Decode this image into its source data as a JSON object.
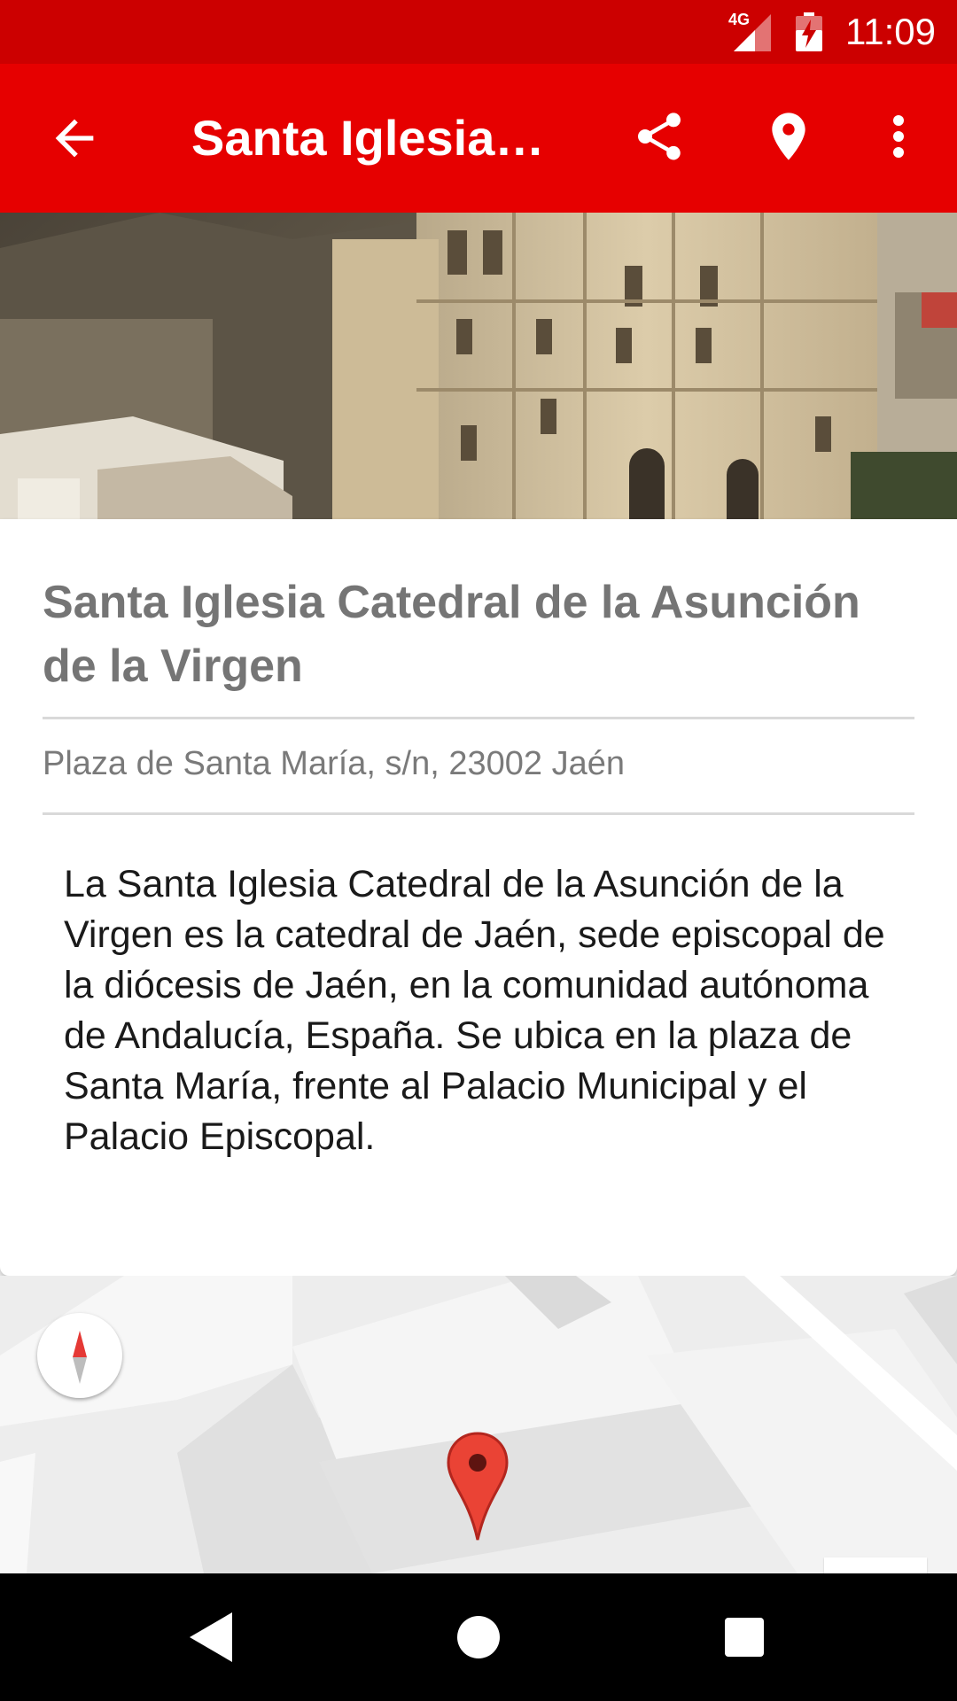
{
  "status_bar": {
    "network": "4G",
    "time": "11:09",
    "icons": [
      "signal-icon",
      "battery-charging-icon"
    ]
  },
  "app_bar": {
    "title": "Santa Iglesia Catedral de la Asunción de la Virgen",
    "icons": [
      "arrow-back-icon",
      "share-icon",
      "location-pin-icon",
      "more-vert-icon"
    ],
    "color": "#e60000"
  },
  "place": {
    "name": "Santa Iglesia Catedral de la Asunción de la Virgen",
    "address": "Plaza de Santa María, s/n, 23002 Jaén",
    "description": "La Santa Iglesia Catedral de la Asunción de la Virgen es la catedral de Jaén, sede episcopal de la diócesis de Jaén, en la comunidad autónoma de Andalucía, España. Se ubica en la plaza de Santa María, frente al Palacio Municipal y el Palacio Episcopal."
  },
  "map": {
    "icons": [
      "compass-icon",
      "map-marker-icon"
    ]
  },
  "nav_bar": {
    "icons": [
      "nav-back-icon",
      "nav-home-icon",
      "nav-recents-icon"
    ]
  }
}
